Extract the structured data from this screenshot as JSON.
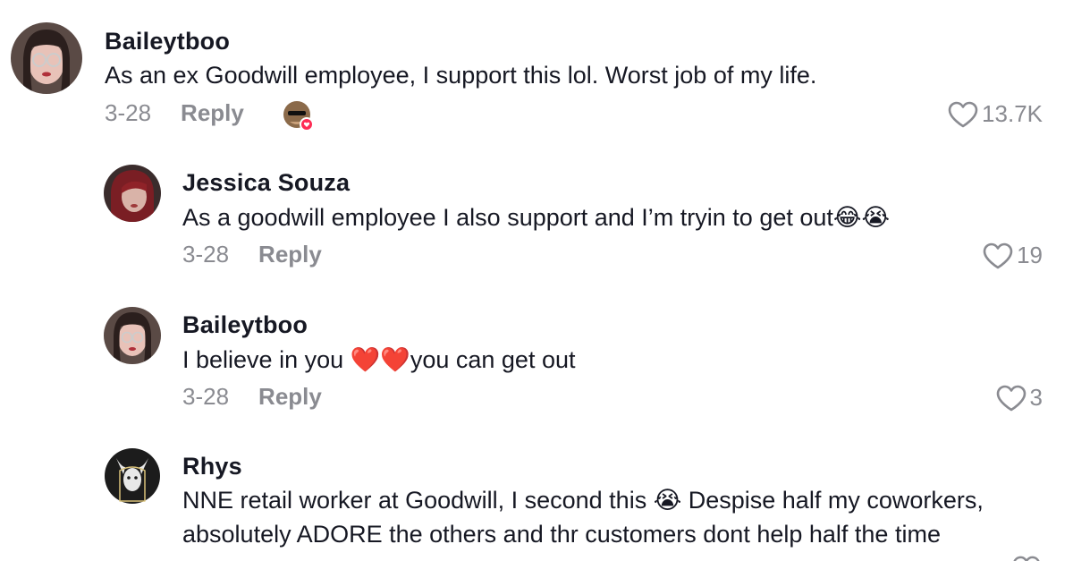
{
  "comments": [
    {
      "username": "Baileytboo",
      "text": "As an ex Goodwill employee, I support this lol. Worst job of my life.",
      "date": "3-28",
      "reply_label": "Reply",
      "likes": "13.7K",
      "liked_by_creator": true
    },
    {
      "username": "Jessica Souza",
      "text": "As a goodwill employee I also support and I’m tryin to get out😂😭",
      "date": "3-28",
      "reply_label": "Reply",
      "likes": "19"
    },
    {
      "username": "Baileytboo",
      "text": "I believe in you ❤️❤️you can get out",
      "date": "3-28",
      "reply_label": "Reply",
      "likes": "3"
    },
    {
      "username": "Rhys",
      "text_line1": "NNE retail worker at Goodwill, I second this 😭 Despise half my coworkers,",
      "text_line2": "absolutely ADORE the others and thr customers dont help half the time"
    }
  ],
  "colors": {
    "primary_text": "#161823",
    "secondary_text": "#8a8b91",
    "badge_red": "#fe2c55"
  }
}
